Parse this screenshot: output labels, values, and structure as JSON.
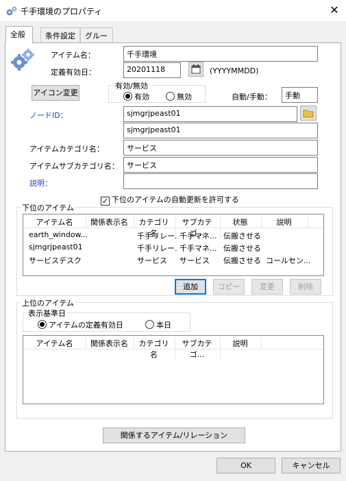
{
  "window": {
    "title": "千手環境のプロパティ",
    "close_label": "✕"
  },
  "tabs": [
    "全般",
    "条件設定",
    "グループ"
  ],
  "form": {
    "item_name_label": "アイテム名：",
    "item_name_value": "千手環境",
    "expiry_label": "定義有効日：",
    "expiry_value": "20201118",
    "expiry_format": "(YYYYMMDD)",
    "icon_change_label": "アイコン変更",
    "valid_group_title": "有効/無効",
    "valid_on_label": "有効",
    "valid_off_label": "無効",
    "auto_manual_label": "自動/手動：",
    "auto_manual_value": "手動",
    "node_id_label": "ノードID：",
    "node_id_value": "sjmgrjpeast01",
    "node_id_value2": "sjmgrjpeast01",
    "category_label": "アイテムカテゴリ名：",
    "category_value": "サービス",
    "subcategory_label": "アイテムサブカテゴリ名：",
    "subcategory_value": "サービス",
    "description_label": "説明：",
    "description_value": "",
    "auto_update_label": "下位のアイテムの自動更新を許可する"
  },
  "lower_items": {
    "title": "下位のアイテム",
    "columns": [
      "アイテム名",
      "関係表示名",
      "カテゴリ名",
      "サブカテゴ...",
      "状態",
      "説明"
    ],
    "rows": [
      [
        "earth_window...",
        "",
        "千手リレー...",
        "千手マネ...",
        "伝搬させる",
        ""
      ],
      [
        "sjmgrjpeast01",
        "",
        "千手リレー...",
        "千手マネ...",
        "伝搬させる",
        ""
      ],
      [
        "サービスデスク",
        "",
        "サービス",
        "サービス",
        "伝搬させる",
        "コールセン..."
      ]
    ],
    "buttons": {
      "add": "追加",
      "copy": "コピー",
      "change": "変更",
      "delete": "削除"
    }
  },
  "upper_items": {
    "title": "上位のアイテム",
    "basis_title": "表示基準日",
    "basis_opt1": "アイテムの定義有効日",
    "basis_opt2": "本日",
    "columns": [
      "アイテム名",
      "関係表示名",
      "カテゴリ名",
      "サブカテゴ...",
      "説明"
    ]
  },
  "relation_button": "関係するアイテム/リレーション",
  "footer": {
    "ok": "OK",
    "cancel": "キャンセル"
  }
}
